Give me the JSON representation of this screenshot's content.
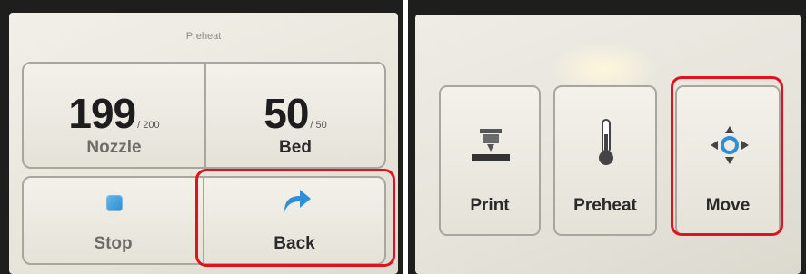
{
  "left_screen": {
    "title": "Preheat",
    "nozzle": {
      "current": "199",
      "target": "/ 200",
      "label": "Nozzle"
    },
    "bed": {
      "current": "50",
      "target": "/ 50",
      "label": "Bed"
    },
    "stop_label": "Stop",
    "back_label": "Back"
  },
  "right_screen": {
    "print_label": "Print",
    "preheat_label": "Preheat",
    "move_label": "Move"
  },
  "colors": {
    "highlight": "#e0121e",
    "accent_blue": "#2f8ed6"
  },
  "icons": [
    "stop-icon",
    "back-arrow-icon",
    "print-head-icon",
    "thermometer-icon",
    "move-arrows-icon"
  ]
}
